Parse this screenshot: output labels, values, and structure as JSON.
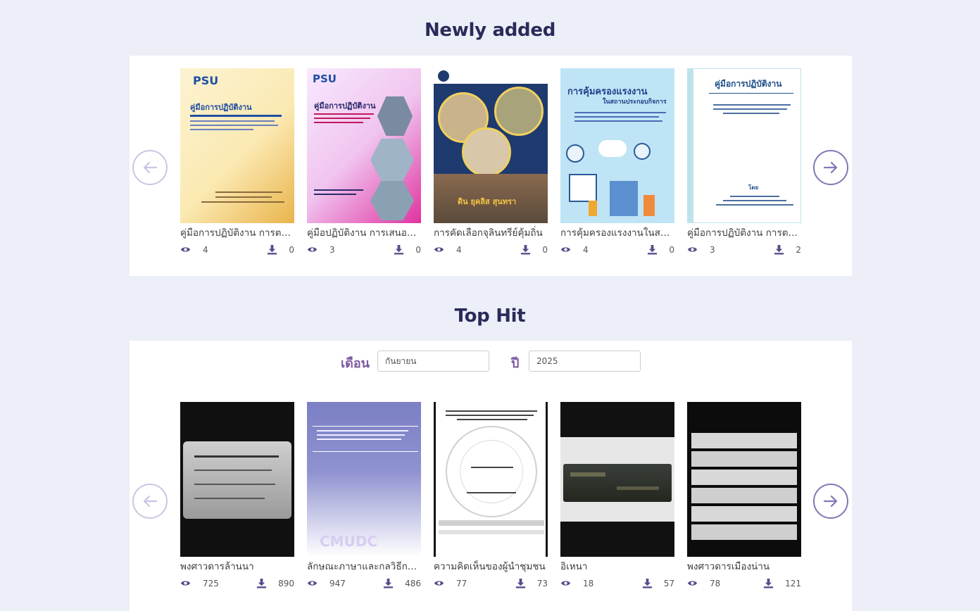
{
  "newly_added": {
    "title": "Newly added",
    "items": [
      {
        "title": "คู่มือการปฏิบัติงาน การตรวจสอบเงินยืม",
        "views": "4",
        "downloads": "0",
        "cover_heading": "คู่มือการปฏิบัติงาน",
        "cover_logo": "PSU"
      },
      {
        "title": "คู่มือปฏิบัติงาน การเสนอหลักสูตร",
        "views": "3",
        "downloads": "0",
        "cover_heading": "คู่มือการปฏิบัติงาน",
        "cover_logo": "PSU"
      },
      {
        "title": "การคัดเลือกจุลินทรีย์คุ้มถิ่น",
        "views": "4",
        "downloads": "0",
        "cover_heading": "ดิน ยุคลิส สุนทรา"
      },
      {
        "title": "การคุ้มครองแรงงานในสถานประกอบกิจการ",
        "views": "4",
        "downloads": "0",
        "cover_heading": "การคุ้มครองแรงงาน",
        "cover_sub": "ในสถานประกอบกิจการ"
      },
      {
        "title": "คู่มือการปฏิบัติงาน การตรวจสอบ",
        "views": "3",
        "downloads": "2",
        "cover_heading": "คู่มือการปฏิบัติงาน",
        "cover_sub": "โดย"
      }
    ]
  },
  "top_hit": {
    "title": "Top Hit",
    "month_label": "เดือน",
    "month_value": "กันยายน",
    "year_label": "ปี",
    "year_value": "2025",
    "items": [
      {
        "title": "พงศาวดารล้านนา",
        "views": "725",
        "downloads": "890"
      },
      {
        "title": "ลักษณะภาษาและกลวิธีการใช้ภาษา",
        "views": "947",
        "downloads": "486",
        "cover_watermark": "CMUDC"
      },
      {
        "title": "ความคิดเห็นของผู้นำชุมชน",
        "views": "77",
        "downloads": "73"
      },
      {
        "title": "อิเหนา",
        "views": "18",
        "downloads": "57"
      },
      {
        "title": "พงศาวดารเมืองน่าน",
        "views": "78",
        "downloads": "121"
      }
    ]
  },
  "icons": {
    "prev": "arrow-left-icon",
    "next": "arrow-right-icon",
    "views": "eye-icon",
    "downloads": "download-icon"
  },
  "colors": {
    "heading": "#2b2a5a",
    "accent": "#7c5aa0",
    "icon": "#5a4a8a",
    "background": "#eceff7"
  }
}
